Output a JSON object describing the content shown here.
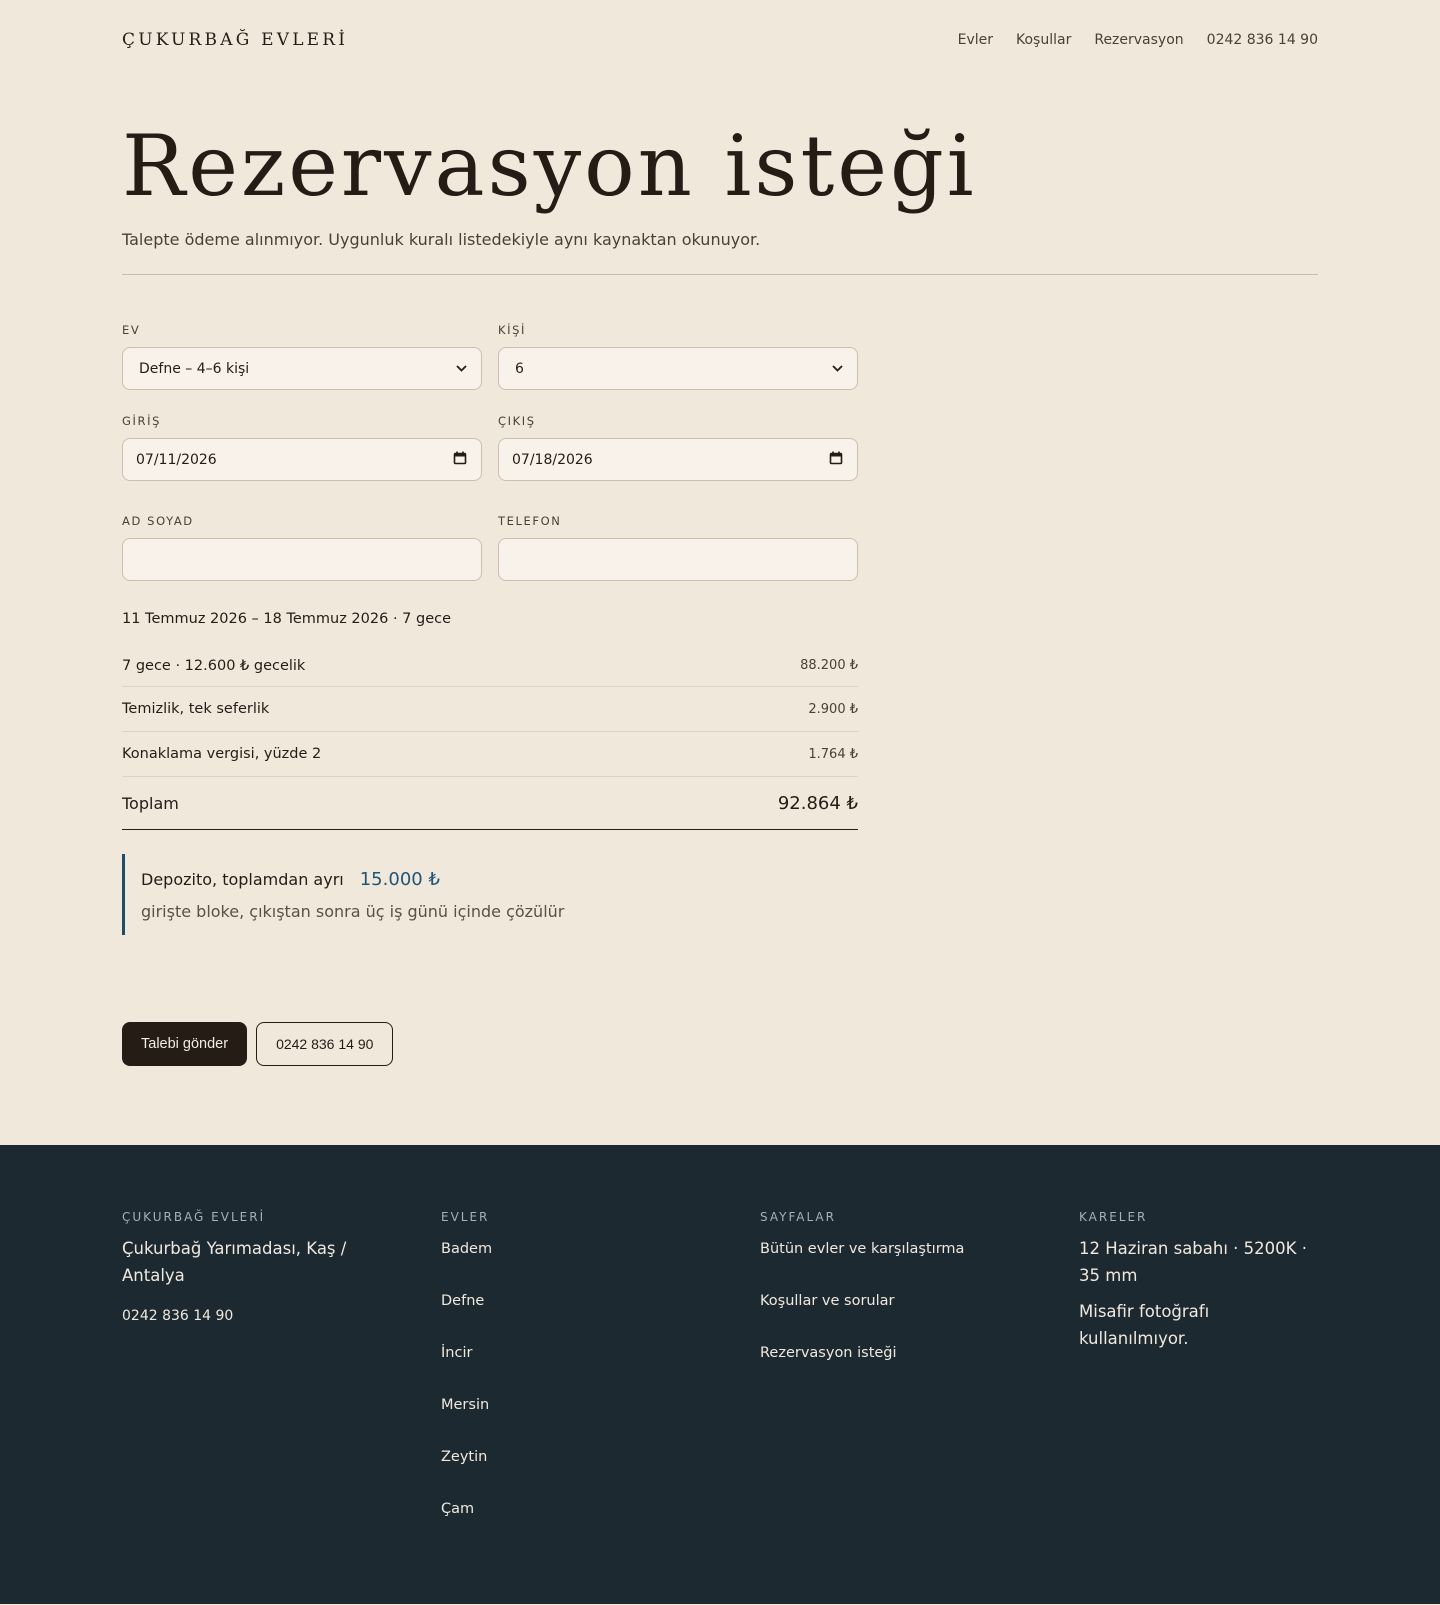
{
  "header": {
    "brand": "ÇUKURBAĞ EVLERİ",
    "nav": [
      "Evler",
      "Koşullar",
      "Rezervasyon",
      "0242 836 14 90"
    ]
  },
  "hero": {
    "title": "Rezervasyon isteği",
    "lede": "Talepte ödeme alınmıyor. Uygunluk kuralı listedekiyle aynı kaynaktan okunuyor."
  },
  "form": {
    "house": {
      "label": "EV",
      "value": "Defne – 4–6 kişi"
    },
    "guests": {
      "label": "KİŞİ",
      "value": "6"
    },
    "checkin": {
      "label": "GİRİŞ",
      "value": "07/11/2026"
    },
    "checkout": {
      "label": "ÇIKIŞ",
      "value": "07/18/2026"
    },
    "name": {
      "label": "AD SOYAD",
      "value": ""
    },
    "phone": {
      "label": "TELEFON",
      "value": ""
    }
  },
  "summary": {
    "range": "11 Temmuz 2026 – 18 Temmuz 2026 · 7 gece",
    "lines": [
      {
        "label": "7 gece · 12.600 ₺ gecelik",
        "amount": "88.200 ₺"
      },
      {
        "label": "Temizlik, tek seferlik",
        "amount": "2.900 ₺"
      },
      {
        "label": "Konaklama vergisi, yüzde 2",
        "amount": "1.764 ₺"
      }
    ],
    "total_label": "Toplam",
    "total_amount": "92.864 ₺"
  },
  "deposit": {
    "label": "Depozito, toplamdan ayrı",
    "amount": "15.000 ₺",
    "note": "girişte bloke, çıkıştan sonra üç iş günü içinde çözülür"
  },
  "actions": {
    "submit": "Talebi gönder",
    "phone": "0242 836 14 90"
  },
  "footer": {
    "brand_head": "ÇUKURBAĞ EVLERİ",
    "address": "Çukurbağ Yarımadası, Kaş / Antalya",
    "phone": "0242 836 14 90",
    "houses_head": "EVLER",
    "houses": [
      "Badem",
      "Defne",
      "İncir",
      "Mersin",
      "Zeytin",
      "Çam"
    ],
    "pages_head": "SAYFALAR",
    "pages": [
      "Bütün evler ve karşılaştırma",
      "Koşullar ve sorular",
      "Rezervasyon isteği"
    ],
    "photos_head": "KARELER",
    "photo_note": "12 Haziran sabahı · 5200K · 35 mm",
    "photo_note2": "Misafir fotoğrafı kullanılmıyor."
  },
  "colors": {
    "background": "#f1e8dc",
    "ink": "#241c15",
    "accent": "#1f5677",
    "footer": "#1c2930"
  }
}
